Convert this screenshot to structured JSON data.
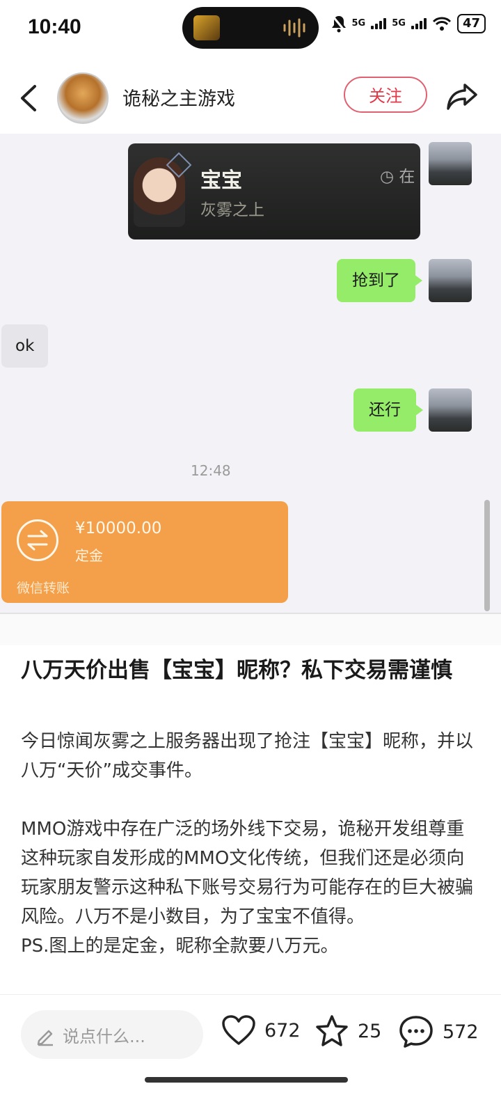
{
  "status_bar": {
    "time": "10:40",
    "net1": "5G",
    "net2": "5G",
    "battery": "47"
  },
  "header": {
    "account_name": "诡秘之主游戏",
    "follow_label": "关注"
  },
  "chat": {
    "card_name": "宝宝",
    "card_subtitle": "灰雾之上",
    "card_status": "在",
    "msg1": "抢到了",
    "msg2": "ok",
    "msg3": "还行",
    "timestamp": "12:48",
    "transfer": {
      "amount": "¥10000.00",
      "label": "定金",
      "footer": "微信转账"
    }
  },
  "article": {
    "title": "八万天价出售【宝宝】昵称？私下交易需谨慎",
    "body": "今日惊闻灰雾之上服务器出现了抢注【宝宝】昵称，并以八万“天价”成交事件。\n\nMMO游戏中存在广泛的场外线下交易，诡秘开发组尊重这种玩家自发形成的MMO文化传统，但我们还是必须向玩家朋友警示这种私下账号交易行为可能存在的巨大被骗风险。八万不是小数目，为了宝宝不值得。\nPS.图上的是定金，昵称全款要八万元。"
  },
  "bottom_bar": {
    "comment_placeholder": "说点什么...",
    "likes": "672",
    "favorites": "25",
    "comments": "572"
  },
  "colors": {
    "follow_red": "#e33848",
    "wechat_green": "#95ec69",
    "transfer_orange": "#f4a04a"
  }
}
